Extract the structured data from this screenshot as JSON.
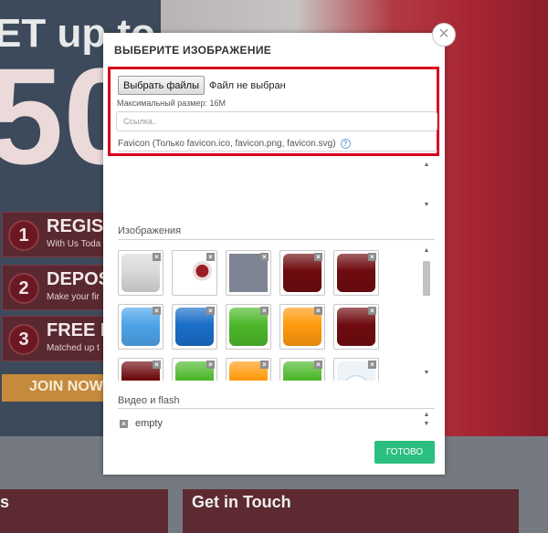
{
  "background": {
    "hero_title": "ET up to",
    "hero_number": "50",
    "steps": [
      {
        "num": "1",
        "title": "REGIST",
        "sub": "With Us Toda"
      },
      {
        "num": "2",
        "title": "DEPOS",
        "sub": "Make your fir"
      },
      {
        "num": "3",
        "title": "FREE B",
        "sub": "Matched up t"
      }
    ],
    "join_button": "JOIN NOW",
    "footer_left": "s",
    "footer_mid": "Get in Touch"
  },
  "modal": {
    "title": "ВЫБЕРИТЕ ИЗОБРАЖЕНИЕ",
    "close_glyph": "×",
    "upload": {
      "choose_button": "Выбрать файлы",
      "file_status": "Файл не выбран",
      "max_size": "Максимальный размер: 16M",
      "link_placeholder": "Ссылка..",
      "favicon_label": "Favicon (Только favicon.ico, favicon.png, favicon.svg)",
      "help_glyph": "?"
    },
    "images_section": {
      "title": "Изображения",
      "thumbs": [
        {
          "name": "thumb-silver",
          "icon": "image-thumbnail",
          "color": "#d9d9d9"
        },
        {
          "name": "thumb-photo",
          "icon": "image-thumbnail",
          "color": "#ffffff"
        },
        {
          "name": "thumb-slate",
          "icon": "image-thumbnail",
          "color": "#7f8494"
        },
        {
          "name": "thumb-maroon-1",
          "icon": "image-thumbnail",
          "color": "#6e0b0f"
        },
        {
          "name": "thumb-maroon-2",
          "icon": "image-thumbnail",
          "color": "#6f0b10"
        },
        {
          "name": "thumb-light-blue",
          "icon": "image-thumbnail",
          "color": "#4da3e8"
        },
        {
          "name": "thumb-blue",
          "icon": "image-thumbnail",
          "color": "#1a6ec9"
        },
        {
          "name": "thumb-green-1",
          "icon": "image-thumbnail",
          "color": "#4cb82a"
        },
        {
          "name": "thumb-orange-1",
          "icon": "image-thumbnail",
          "color": "#ff9a0e"
        },
        {
          "name": "thumb-maroon-3",
          "icon": "image-thumbnail",
          "color": "#6f0b10"
        },
        {
          "name": "thumb-maroon-4",
          "icon": "image-thumbnail",
          "color": "#6e0b0f"
        },
        {
          "name": "thumb-green-2",
          "icon": "image-thumbnail",
          "color": "#4cb82a"
        },
        {
          "name": "thumb-orange-2",
          "icon": "image-thumbnail",
          "color": "#ff9a0e"
        },
        {
          "name": "thumb-green-3",
          "icon": "image-thumbnail",
          "color": "#4cb82a"
        },
        {
          "name": "thumb-pattern",
          "icon": "image-thumbnail",
          "color": "#eef3f7"
        }
      ],
      "delete_glyph": "×"
    },
    "video_section": {
      "title": "Видео и flash",
      "empty_label": "empty",
      "check_glyph": "×"
    },
    "done_button": "ГОТОВО"
  },
  "icons": {
    "scroll_up": "▲",
    "scroll_down": "▼"
  },
  "colors": {
    "highlight_border": "#d6001c",
    "done_button": "#2bbf7f"
  }
}
